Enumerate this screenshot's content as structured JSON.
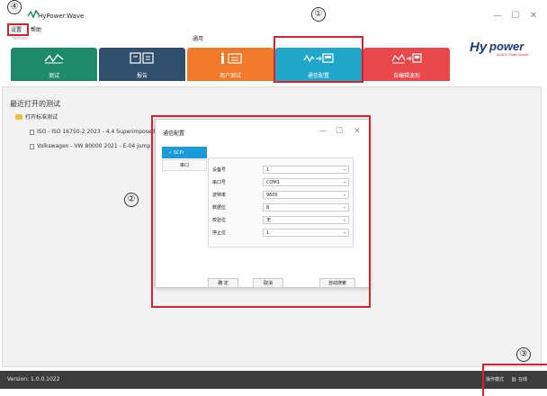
{
  "window": {
    "title": "HyPower.Wave",
    "subtitle": "HyPower",
    "controls": [
      "—",
      "☐",
      "✕"
    ]
  },
  "menu": [
    "设置",
    "帮助"
  ],
  "ribbon": {
    "group_label": "通用",
    "tiles": [
      {
        "label": "测试",
        "color": "#1e8a6a"
      },
      {
        "label": "报告",
        "color": "#2f4f6a"
      },
      {
        "label": "用户测试",
        "color": "#f07a2a"
      },
      {
        "label": "通信配置",
        "color": "#1fa6c8"
      },
      {
        "label": "自编辑波形",
        "color": "#e8484a"
      }
    ]
  },
  "brand": {
    "name": "power",
    "prefix": "Hy",
    "tagline": "AC&DC Power Source"
  },
  "workspace": {
    "recent_title": "最近打开的测试",
    "open_local": "打开标准测试",
    "recent_items": [
      "ISO - ISO 16750-2 2023 - 4.4 Superimposed",
      "Volkswagen - VW 80000 2021 - E-04 jump"
    ]
  },
  "dialog": {
    "title": "通信配置",
    "nav": [
      {
        "label": "SCPI",
        "active": true,
        "check": "✓"
      },
      {
        "label": "串口",
        "active": false
      }
    ],
    "fields": [
      {
        "label": "设备号",
        "value": "1"
      },
      {
        "label": "串口号",
        "value": "COM1"
      },
      {
        "label": "波特率",
        "value": "9600"
      },
      {
        "label": "数据位",
        "value": "8"
      },
      {
        "label": "校验位",
        "value": "无"
      },
      {
        "label": "停止位",
        "value": "1"
      }
    ],
    "buttons": {
      "ok": "确 定",
      "cancel": "取消",
      "auto_search": "自动搜索"
    }
  },
  "status": {
    "version": "Version: 1.0.0.1022",
    "mode": "操作模式",
    "online": "在线"
  },
  "annotations": [
    "④",
    "①",
    "②",
    "③"
  ],
  "colors": {
    "accent": "#1a9ad6",
    "annotation": "#d9222a"
  }
}
